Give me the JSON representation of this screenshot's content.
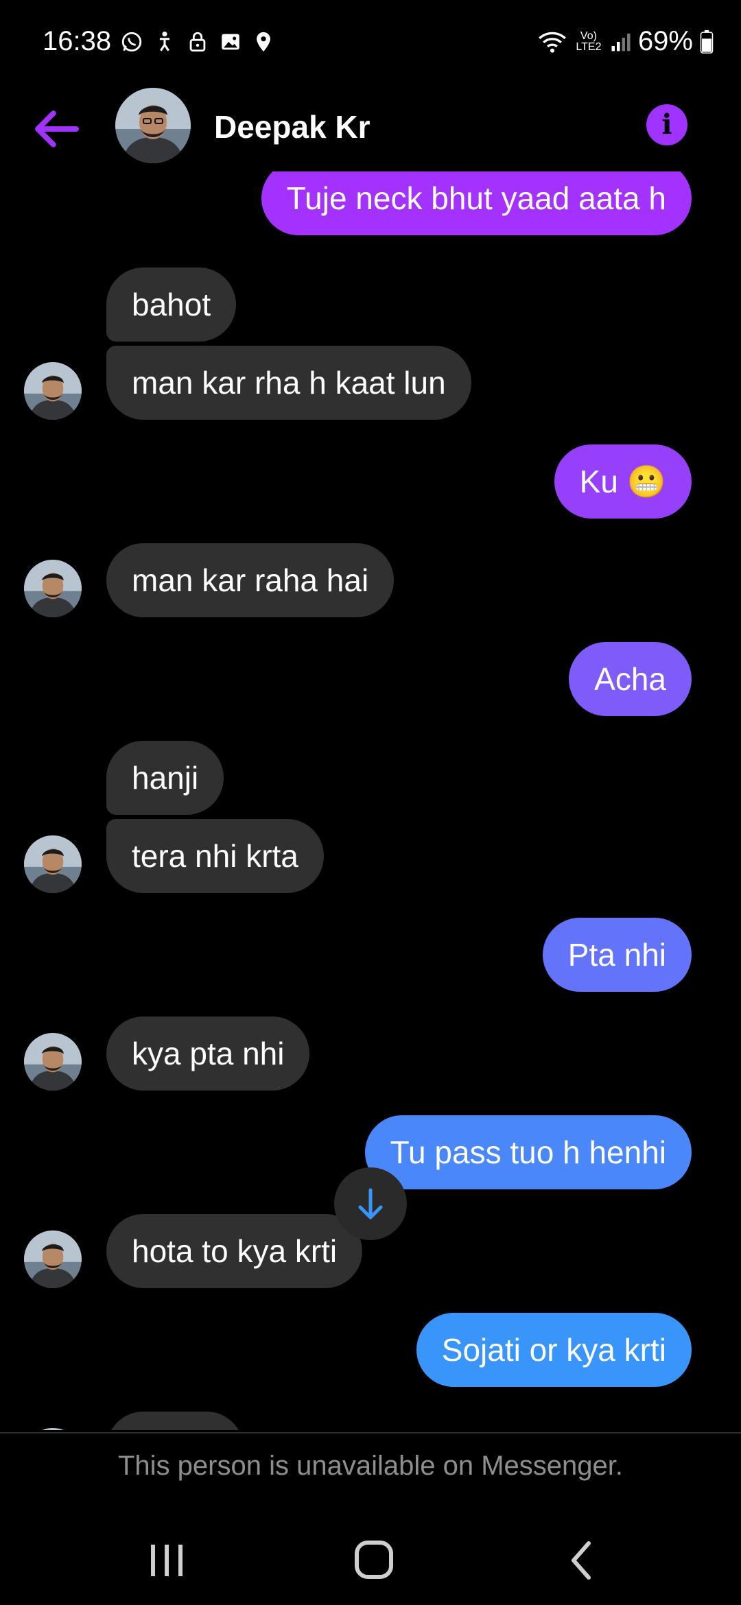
{
  "status_bar": {
    "time": "16:38",
    "battery": "69%",
    "network_label": "Vo) LTE2",
    "icons": [
      "whatsapp-icon",
      "accessibility-icon",
      "lock-icon",
      "gallery-icon",
      "location-icon",
      "wifi-icon",
      "signal-icon",
      "battery-icon"
    ]
  },
  "header": {
    "contact_name": "Deepak Kr",
    "info_glyph": "i"
  },
  "messages": [
    {
      "from": "me",
      "text": "Tuje neck bhut yaad aata h"
    },
    {
      "from": "them",
      "text": "bahot"
    },
    {
      "from": "them",
      "text": "man kar rha h kaat lun"
    },
    {
      "from": "me",
      "text": "Ku 😬"
    },
    {
      "from": "them",
      "text": "man kar raha hai"
    },
    {
      "from": "me",
      "text": "Acha"
    },
    {
      "from": "them",
      "text": "hanji"
    },
    {
      "from": "them",
      "text": "tera nhi krta"
    },
    {
      "from": "me",
      "text": "Pta nhi"
    },
    {
      "from": "them",
      "text": "kya pta nhi"
    },
    {
      "from": "me",
      "text": "Tu pass tuo h henhi"
    },
    {
      "from": "them",
      "text": "hota to kya krti"
    },
    {
      "from": "me",
      "text": "Sojati or kya krti"
    }
  ],
  "footer": {
    "notice": "This person is unavailable on Messenger."
  },
  "colors": {
    "accent": "#a033ff",
    "gradient_top": "#a832ff",
    "gradient_bottom": "#3a95fa",
    "incoming_bubble": "#303030"
  }
}
